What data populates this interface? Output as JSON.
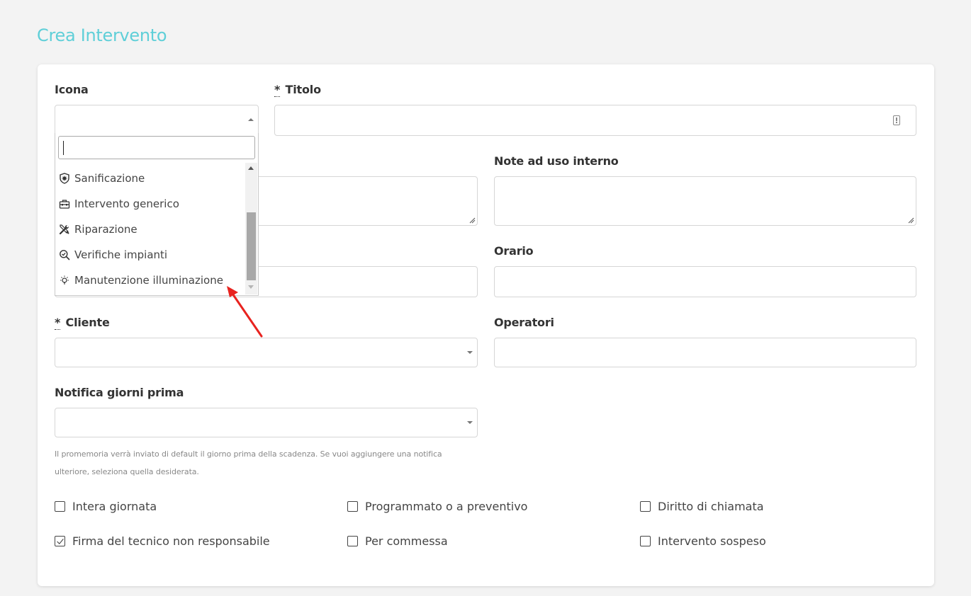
{
  "page": {
    "title": "Crea Intervento"
  },
  "form": {
    "icona_label": "Icona",
    "titolo_required": "*",
    "titolo_label": "Titolo",
    "note_interne_label": "Note ad uso interno",
    "orario_label": "Orario",
    "cliente_required": "*",
    "cliente_label": "Cliente",
    "operatori_label": "Operatori",
    "notifica_label": "Notifica giorni prima",
    "help_text": "Il promemoria verrà inviato di default il giorno prima della scadenza. Se vuoi aggiungere una notifica ulteriore, seleziona quella desiderata."
  },
  "dropdown": {
    "search_value": "",
    "items": [
      {
        "label": "Sanificazione",
        "icon": "shield-virus-icon"
      },
      {
        "label": "Intervento generico",
        "icon": "toolbox-icon"
      },
      {
        "label": "Riparazione",
        "icon": "tools-icon"
      },
      {
        "label": "Verifiche impianti",
        "icon": "search-check-icon"
      },
      {
        "label": "Manutenzione illuminazione",
        "icon": "lightbulb-icon"
      }
    ]
  },
  "checkboxes": [
    {
      "label": "Intera giornata",
      "checked": false
    },
    {
      "label": "Programmato o a preventivo",
      "checked": false
    },
    {
      "label": "Diritto di chiamata",
      "checked": false
    },
    {
      "label": "Firma del tecnico non responsabile",
      "checked": true
    },
    {
      "label": "Per commessa",
      "checked": false
    },
    {
      "label": "Intervento sospeso",
      "checked": false
    }
  ],
  "colors": {
    "accent": "#5fcfd8",
    "arrow": "#e8231f"
  }
}
